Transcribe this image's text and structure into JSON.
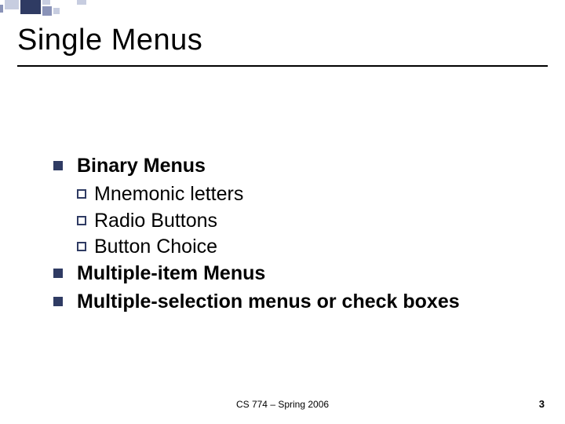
{
  "title": "Single Menus",
  "bullets": {
    "b0": {
      "label": "Binary Menus",
      "sub": {
        "s0": "Mnemonic letters",
        "s1": "Radio Buttons",
        "s2": "Button Choice"
      }
    },
    "b1": {
      "label": "Multiple-item Menus"
    },
    "b2": {
      "label": "Multiple-selection menus or check boxes"
    }
  },
  "footer": {
    "center": "CS 774 – Spring 2006",
    "page": "3"
  },
  "deco_colors": {
    "dark": "#2f3b63",
    "mid": "#8a93b8",
    "light": "#c7cde0"
  }
}
